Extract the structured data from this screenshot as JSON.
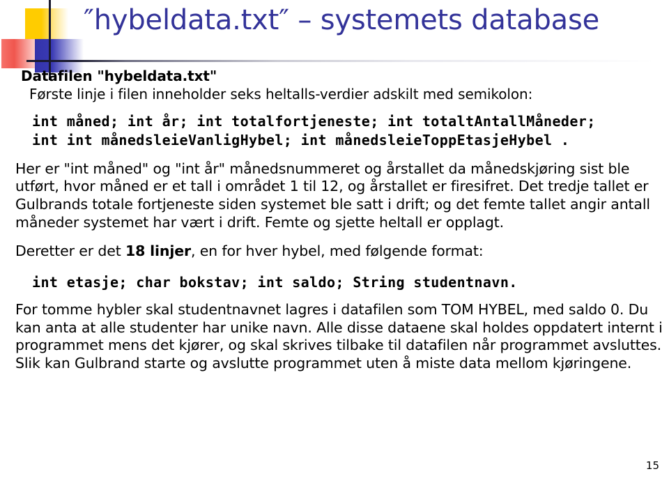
{
  "slide": {
    "title": "″hybeldata.txt″ – systemets database",
    "title_color": "#333399",
    "page_number": "15"
  },
  "content": {
    "lead_heading": "Datafilen \"hybeldata.txt\"",
    "lead_subtitle": "Første linje i filen inneholder seks heltalls-verdier adskilt med semikolon:",
    "code_block_1": [
      "int måned; int år; int totalfortjeneste; int totaltAntallMåneder;",
      "int int månedsleieVanligHybel; int månedsleieToppEtasjeHybel ."
    ],
    "paragraph_1": "Her er \"int måned\" og \"int år\" månedsnummeret og årstallet da månedskjøring sist ble utført, hvor måned er et tall i området 1 til 12, og årstallet er firesifret. Det tredje tallet er Gulbrands totale fortjeneste siden systemet ble satt i drift; og det femte tallet angir antall måneder systemet har vært i drift.  Femte og sjette heltall er opplagt.",
    "paragraph_2_pre": "Deretter er det ",
    "paragraph_2_bold": "18 linjer",
    "paragraph_2_post": ", en for hver hybel, med følgende format:",
    "code_block_2": "int etasje; char bokstav; int saldo; String studentnavn.",
    "paragraph_3": "For tomme hybler skal studentnavnet lagres i datafilen som TOM HYBEL, med saldo 0. Du kan anta at alle studenter har unike navn. Alle disse dataene skal holdes oppdatert internt i programmet mens det kjører, og skal skrives tilbake til datafilen når programmet avsluttes. Slik kan Gulbrand starte og avslutte programmet uten å miste data mellom kjøringene."
  }
}
